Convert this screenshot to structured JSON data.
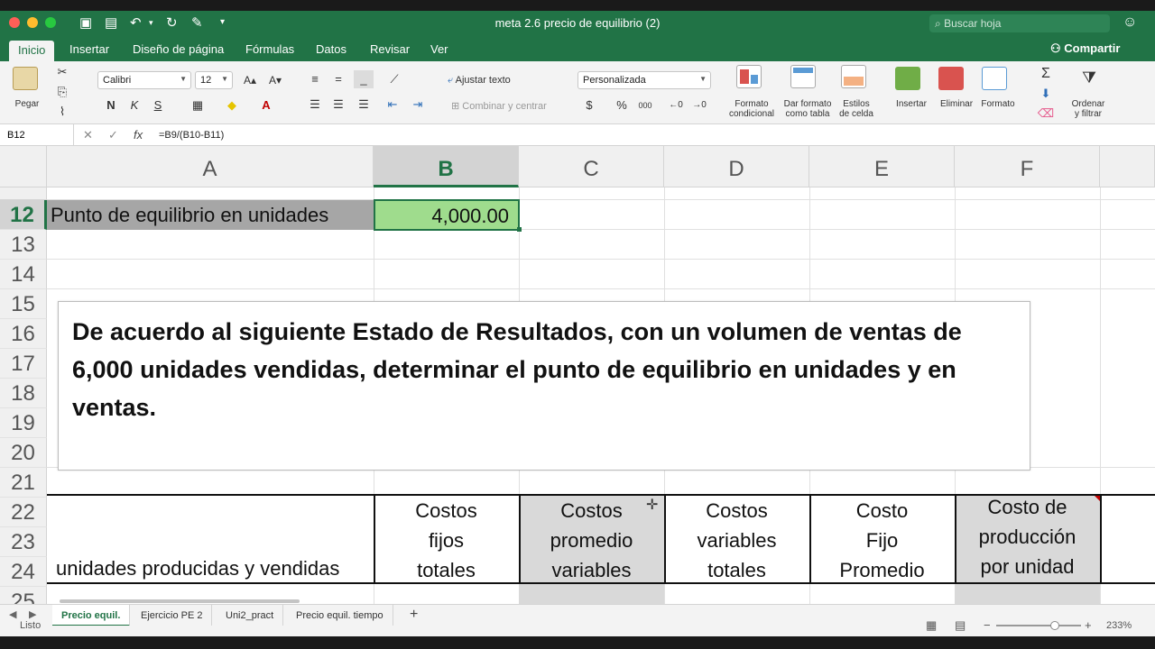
{
  "title": "meta 2.6 precio de equilibrio (2)",
  "search_placeholder": "Buscar hoja",
  "tabs": [
    "Inicio",
    "Insertar",
    "Diseño de página",
    "Fórmulas",
    "Datos",
    "Revisar",
    "Ver"
  ],
  "share": "Compartir",
  "ribbon": {
    "paste": "Pegar",
    "font": "Calibri",
    "size": "12",
    "bold": "N",
    "italic": "K",
    "underline": "S",
    "wrap": "Ajustar texto",
    "merge": "Combinar y centrar",
    "number_format": "Personalizada",
    "currency": "$",
    "percent": "%",
    "thousands": "000",
    "cond_format": [
      "Formato",
      "condicional"
    ],
    "table_format": [
      "Dar formato",
      "como tabla"
    ],
    "cell_styles": [
      "Estilos",
      "de celda"
    ],
    "insert": "Insertar",
    "delete": "Eliminar",
    "format": "Formato",
    "sort": [
      "Ordenar",
      "y filtrar"
    ]
  },
  "namebox": "B12",
  "formula": "=B9/(B10-B11)",
  "columns": [
    "A",
    "B",
    "C",
    "D",
    "E",
    "F"
  ],
  "rows": [
    "12",
    "13",
    "14",
    "15",
    "16",
    "17",
    "18",
    "19",
    "20",
    "21",
    "22",
    "23",
    "24",
    "25"
  ],
  "cells": {
    "a12": "Punto de equilibrio en unidades",
    "b12": "4,000.00",
    "a24": "unidades producidas y vendidas"
  },
  "headers": [
    [
      "Costos",
      "fijos",
      "totales"
    ],
    [
      "Costos",
      "promedio",
      "variables"
    ],
    [
      "Costos",
      "variables",
      "totales"
    ],
    [
      "Costo",
      "Fijo",
      "Promedio"
    ],
    [
      "Costo de",
      "producción",
      "por unidad"
    ]
  ],
  "textbox": "De acuerdo al siguiente Estado de Resultados, con un volumen de ventas de 6,000 unidades vendidas, determinar el punto de equilibrio en unidades y en ventas.",
  "sheets": [
    "Precio equil.",
    "Ejercicio PE 2",
    "Uni2_pract",
    "Precio equil. tiempo"
  ],
  "status": "Listo",
  "zoom": "233%",
  "colors": {
    "excel_green": "#217346",
    "selected_cell": "#9fdc8d"
  }
}
